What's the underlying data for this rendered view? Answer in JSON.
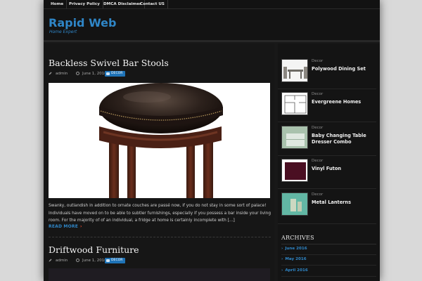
{
  "nav": {
    "items": [
      "Home",
      "Privacy Policy",
      "DMCA Disclaimer",
      "Contact US"
    ]
  },
  "site": {
    "title": "Rapid Web",
    "tagline": "Home Expert"
  },
  "posts": [
    {
      "title": "Backless Swivel Bar Stools",
      "author": "admin",
      "date": "June 1, 2016",
      "category": "DECOR",
      "excerpt": "Swanky, outlandish in addition to ornate couches are passé now, if you do not stay in some sort of palace! Individuals have moved on to be able to subtler furnishings, especially if you possess a bar inside your living room. For the majority of of an individual, a fridge at home is certainly incomplete with [...]",
      "read_more": "READ MORE"
    },
    {
      "title": "Driftwood Furniture",
      "author": "admin",
      "date": "June 1, 2016",
      "category": "DECOR"
    }
  ],
  "sidebar": {
    "recent": [
      {
        "category": "Decor",
        "title": "Polywood Dining Set"
      },
      {
        "category": "Decor",
        "title": "Evergreene Homes"
      },
      {
        "category": "Decor",
        "title": "Baby Changing Table Dresser Combo"
      },
      {
        "category": "Decor",
        "title": "Vinyl Futon"
      },
      {
        "category": "Decor",
        "title": "Metal Lanterns"
      }
    ],
    "archives_title": "ARCHIVES",
    "archives": [
      "June 2016",
      "May 2016",
      "April 2016"
    ]
  },
  "colors": {
    "accent": "#2f86c7",
    "badge": "#1f73b7",
    "chevron": "#e0452a",
    "background": "#181818"
  }
}
